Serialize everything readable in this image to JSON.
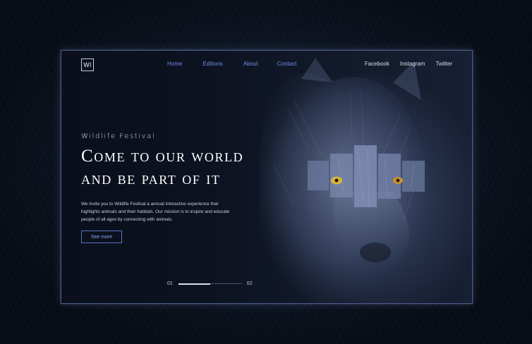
{
  "logo": {
    "text": "Wl"
  },
  "nav": {
    "items": [
      {
        "label": "Home"
      },
      {
        "label": "Editions"
      },
      {
        "label": "About"
      },
      {
        "label": "Contact"
      }
    ]
  },
  "social": {
    "items": [
      {
        "label": "Facebook"
      },
      {
        "label": "Instagram"
      },
      {
        "label": "Twitter"
      }
    ]
  },
  "hero": {
    "eyebrow": "Wildlife Festival",
    "headline_line1": "Come to our world",
    "headline_line2": "and be part of it",
    "description": "We invite you to Wildlife Festival a annual interactive experience that highlights animals and their habitats. Our mission is to inspire and educate people of all ages by connecting with animals.",
    "cta_label": "See more"
  },
  "slider": {
    "current": "01",
    "next": "02",
    "progress": 0.5
  },
  "colors": {
    "accent": "#6f8fe6",
    "frame_border": "#4a5a86",
    "background": "#0a0f1b",
    "wolf_eye": "#d9b43a"
  }
}
